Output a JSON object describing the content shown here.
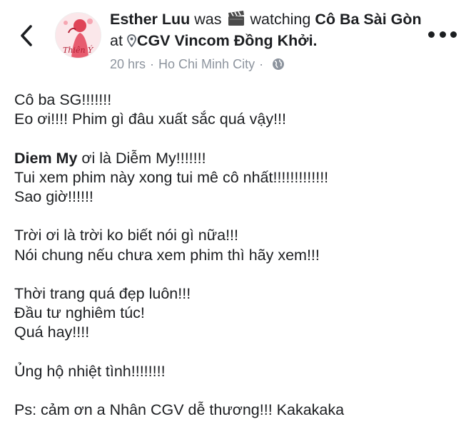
{
  "header": {
    "back_icon": "chevron-left-icon",
    "author": "Esther Luu",
    "was": "was",
    "activity_icon": "clapper-board-icon",
    "activity": "watching",
    "movie": "Cô Ba Sài Gòn",
    "at": "at",
    "location_icon": "map-pin-icon",
    "location": "CGV Vincom Đồng Khởi.",
    "time": "20 hrs",
    "separator": "·",
    "city": "Ho Chi Minh City",
    "privacy_icon": "globe-icon",
    "more_icon": "more-horizontal-icon",
    "avatar_text": "Thiên Ý"
  },
  "post": {
    "line1": "Cô ba SG!!!!!!!",
    "line2": "Eo ơi!!!! Phim gì đâu xuất sắc quá vậy!!!",
    "line3_bold": "Diem My",
    "line3_rest": " ơi là Diễm My!!!!!!!",
    "line4": "Tui xem phim này xong tui mê cô nhất!!!!!!!!!!!!!",
    "line5": "Sao giờ!!!!!!",
    "line6": "Trời ơi là trời ko biết nói gì nữa!!!",
    "line7": "Nói chung nếu chưa xem phim thì hãy xem!!!",
    "line8": "Thời trang quá đẹp luôn!!!",
    "line9": "Đầu tư nghiêm túc!",
    "line10": "Quá hay!!!!",
    "line11": "Ủng hộ nhiệt tình!!!!!!!!",
    "line12": "Ps: cảm ơn a Nhân CGV dễ thương!!! Kakakaka"
  },
  "colors": {
    "text": "#1c1e21",
    "meta": "#8d949e",
    "avatar_bg": "#fbe7ea",
    "avatar_accent": "#d9273d"
  }
}
